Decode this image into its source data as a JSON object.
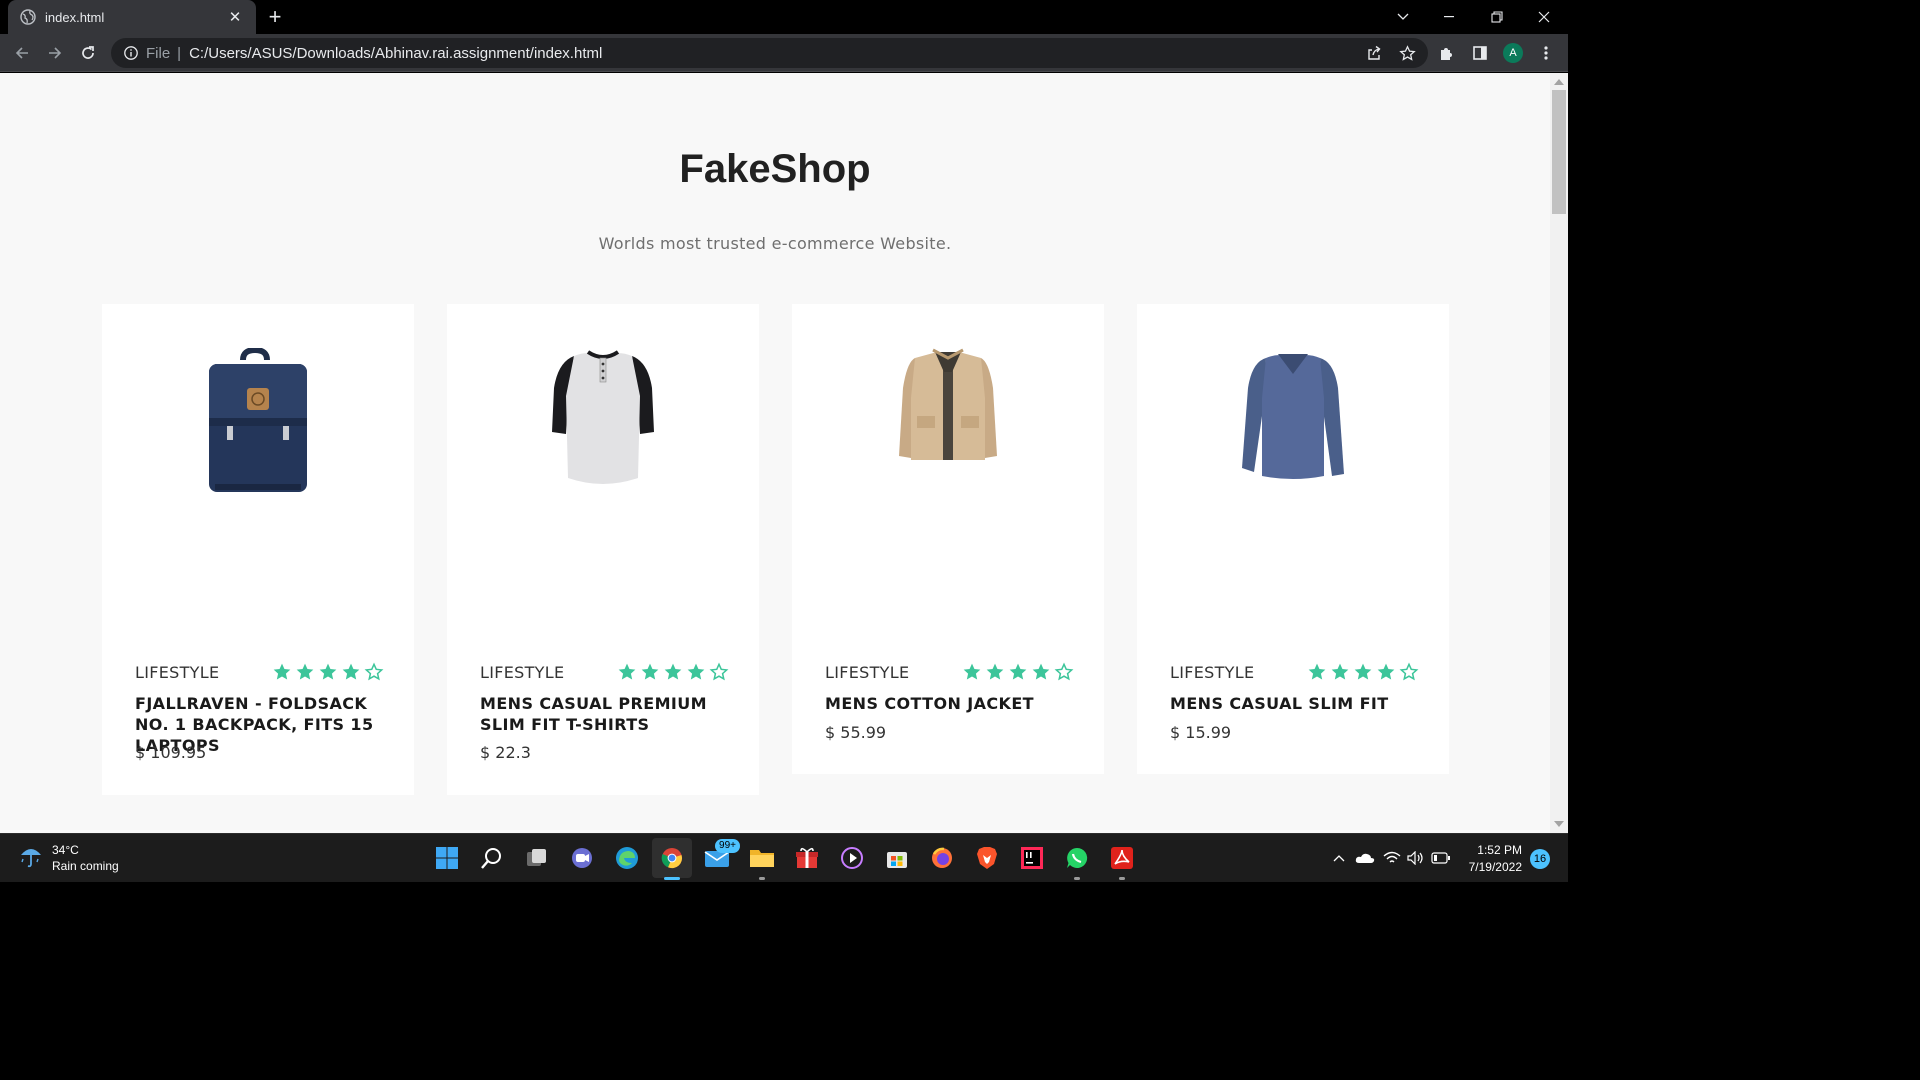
{
  "browser": {
    "tab_title": "index.html",
    "new_tab": "+",
    "tab_close": "✕",
    "omnibox": {
      "scheme": "File",
      "separator": "|",
      "url": "C:/Users/ASUS/Downloads/Abhinav.rai.assignment/index.html"
    },
    "profile_initial": "A"
  },
  "page": {
    "title": "FakeShop",
    "subtitle": "Worlds most trusted e-commerce Website.",
    "products": [
      {
        "category": "LIFESTYLE",
        "name": "FJALLRAVEN - FOLDSACK NO. 1 BACKPACK, FITS 15 LAPTOPS",
        "price": "$ 109.95",
        "rating_stars": 4,
        "image": "backpack-image"
      },
      {
        "category": "LIFESTYLE",
        "name": "MENS CASUAL PREMIUM SLIM FIT T-SHIRTS",
        "price": "$ 22.3",
        "rating_stars": 4,
        "image": "raglan-tshirt-image"
      },
      {
        "category": "LIFESTYLE",
        "name": "MENS COTTON JACKET",
        "price": "$ 55.99",
        "rating_stars": 4,
        "image": "jacket-image"
      },
      {
        "category": "LIFESTYLE",
        "name": "MENS CASUAL SLIM FIT",
        "price": "$ 15.99",
        "rating_stars": 4,
        "image": "longsleeve-image"
      }
    ],
    "accent_color": "#3cc59a"
  },
  "taskbar": {
    "weather": {
      "temp": "34°C",
      "condition": "Rain coming"
    },
    "mail_badge": "99+",
    "clock": {
      "time": "1:52 PM",
      "date": "7/19/2022"
    },
    "notifications": "16"
  }
}
